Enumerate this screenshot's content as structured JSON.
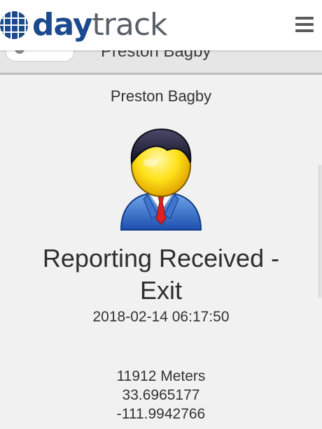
{
  "header": {
    "logo_day": "day",
    "logo_track": "track",
    "menu_icon": "hamburger-menu-icon"
  },
  "sub_bar": {
    "title": "Preston Bagby",
    "back_icon": "back-button-icon"
  },
  "report": {
    "user_name": "Preston Bagby",
    "avatar_icon": "user-avatar-icon",
    "event_title": "Reporting Received - Exit",
    "timestamp": "2018-02-14 06:17:50",
    "distance": "11912 Meters",
    "latitude": "33.6965177",
    "longitude": "-111.9942766"
  },
  "colors": {
    "brand_blue": "#1b4a8f",
    "brand_gray": "#5a6068",
    "background": "#f1f1f1"
  }
}
